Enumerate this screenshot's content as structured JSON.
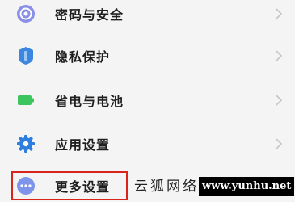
{
  "settings": {
    "items": [
      {
        "label": "密码与安全",
        "icon": "password-security-icon",
        "color": "#8a8fe8"
      },
      {
        "label": "隐私保护",
        "icon": "privacy-shield-icon",
        "color": "#3b86e0"
      },
      {
        "label": "省电与电池",
        "icon": "battery-icon",
        "color": "#3cc45e"
      },
      {
        "label": "应用设置",
        "icon": "app-settings-gear-icon",
        "color": "#2d7fdf"
      },
      {
        "label": "更多设置",
        "icon": "more-settings-icon",
        "color": "#7d94ea"
      }
    ]
  },
  "watermark": {
    "chinese": "云狐网络",
    "url": "www.yunhu.net"
  },
  "colors": {
    "background": "#f4f4f4",
    "highlight_border": "#d9241c",
    "chevron": "#c4c4c4"
  }
}
